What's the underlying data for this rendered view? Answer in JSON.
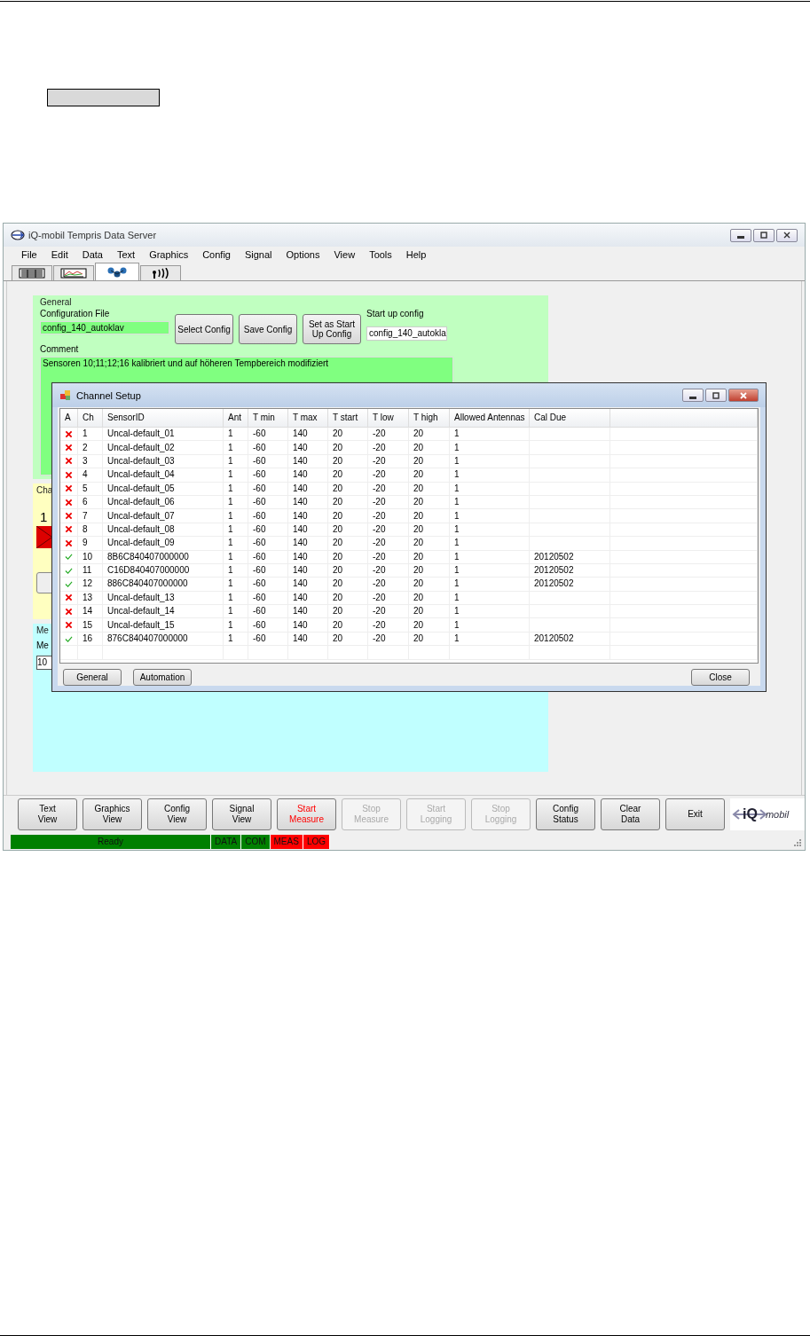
{
  "window": {
    "title": "iQ-mobil Tempris Data Server"
  },
  "menu": [
    "File",
    "Edit",
    "Data",
    "Text",
    "Graphics",
    "Config",
    "Signal",
    "Options",
    "View",
    "Tools",
    "Help"
  ],
  "tabs": [
    {
      "kind": "table",
      "selected": false
    },
    {
      "kind": "chart",
      "selected": false
    },
    {
      "kind": "network",
      "selected": true
    },
    {
      "kind": "antenna",
      "selected": false
    }
  ],
  "general": {
    "title": "General",
    "config_file_label": "Configuration File",
    "config_file": "config_140_autoklav",
    "buttons": [
      "Select Config",
      "Save Config",
      "Set as Start Up Config"
    ],
    "startup_label": "Start up config",
    "startup_value": "config_140_autokla",
    "comment_label": "Comment",
    "comment": "Sensoren 10;11;12;16 kalibriert und auf höheren Tempbereich modifiziert"
  },
  "channel_panel": {
    "title": "Cha",
    "value": "1"
  },
  "measure_panel": {
    "title": "Me",
    "label": "Me",
    "value": "10"
  },
  "dialog": {
    "title": "Channel Setup",
    "columns": [
      "A",
      "Ch",
      "SensorID",
      "Ant",
      "T min",
      "T max",
      "T start",
      "T low",
      "T high",
      "Allowed Antennas",
      "Cal Due"
    ],
    "rows": [
      {
        "active": false,
        "ch": "1",
        "sensor": "Uncal-default_01",
        "ant": "1",
        "tmin": "-60",
        "tmax": "140",
        "tstart": "20",
        "tlow": "-20",
        "thigh": "20",
        "allowed": "1",
        "cal_due": ""
      },
      {
        "active": false,
        "ch": "2",
        "sensor": "Uncal-default_02",
        "ant": "1",
        "tmin": "-60",
        "tmax": "140",
        "tstart": "20",
        "tlow": "-20",
        "thigh": "20",
        "allowed": "1",
        "cal_due": ""
      },
      {
        "active": false,
        "ch": "3",
        "sensor": "Uncal-default_03",
        "ant": "1",
        "tmin": "-60",
        "tmax": "140",
        "tstart": "20",
        "tlow": "-20",
        "thigh": "20",
        "allowed": "1",
        "cal_due": ""
      },
      {
        "active": false,
        "ch": "4",
        "sensor": "Uncal-default_04",
        "ant": "1",
        "tmin": "-60",
        "tmax": "140",
        "tstart": "20",
        "tlow": "-20",
        "thigh": "20",
        "allowed": "1",
        "cal_due": ""
      },
      {
        "active": false,
        "ch": "5",
        "sensor": "Uncal-default_05",
        "ant": "1",
        "tmin": "-60",
        "tmax": "140",
        "tstart": "20",
        "tlow": "-20",
        "thigh": "20",
        "allowed": "1",
        "cal_due": ""
      },
      {
        "active": false,
        "ch": "6",
        "sensor": "Uncal-default_06",
        "ant": "1",
        "tmin": "-60",
        "tmax": "140",
        "tstart": "20",
        "tlow": "-20",
        "thigh": "20",
        "allowed": "1",
        "cal_due": ""
      },
      {
        "active": false,
        "ch": "7",
        "sensor": "Uncal-default_07",
        "ant": "1",
        "tmin": "-60",
        "tmax": "140",
        "tstart": "20",
        "tlow": "-20",
        "thigh": "20",
        "allowed": "1",
        "cal_due": ""
      },
      {
        "active": false,
        "ch": "8",
        "sensor": "Uncal-default_08",
        "ant": "1",
        "tmin": "-60",
        "tmax": "140",
        "tstart": "20",
        "tlow": "-20",
        "thigh": "20",
        "allowed": "1",
        "cal_due": ""
      },
      {
        "active": false,
        "ch": "9",
        "sensor": "Uncal-default_09",
        "ant": "1",
        "tmin": "-60",
        "tmax": "140",
        "tstart": "20",
        "tlow": "-20",
        "thigh": "20",
        "allowed": "1",
        "cal_due": ""
      },
      {
        "active": true,
        "ch": "10",
        "sensor": "8B6C840407000000",
        "ant": "1",
        "tmin": "-60",
        "tmax": "140",
        "tstart": "20",
        "tlow": "-20",
        "thigh": "20",
        "allowed": "1",
        "cal_due": "20120502"
      },
      {
        "active": true,
        "ch": "11",
        "sensor": "C16D840407000000",
        "ant": "1",
        "tmin": "-60",
        "tmax": "140",
        "tstart": "20",
        "tlow": "-20",
        "thigh": "20",
        "allowed": "1",
        "cal_due": "20120502"
      },
      {
        "active": true,
        "ch": "12",
        "sensor": "886C840407000000",
        "ant": "1",
        "tmin": "-60",
        "tmax": "140",
        "tstart": "20",
        "tlow": "-20",
        "thigh": "20",
        "allowed": "1",
        "cal_due": "20120502"
      },
      {
        "active": false,
        "ch": "13",
        "sensor": "Uncal-default_13",
        "ant": "1",
        "tmin": "-60",
        "tmax": "140",
        "tstart": "20",
        "tlow": "-20",
        "thigh": "20",
        "allowed": "1",
        "cal_due": ""
      },
      {
        "active": false,
        "ch": "14",
        "sensor": "Uncal-default_14",
        "ant": "1",
        "tmin": "-60",
        "tmax": "140",
        "tstart": "20",
        "tlow": "-20",
        "thigh": "20",
        "allowed": "1",
        "cal_due": ""
      },
      {
        "active": false,
        "ch": "15",
        "sensor": "Uncal-default_15",
        "ant": "1",
        "tmin": "-60",
        "tmax": "140",
        "tstart": "20",
        "tlow": "-20",
        "thigh": "20",
        "allowed": "1",
        "cal_due": ""
      },
      {
        "active": true,
        "ch": "16",
        "sensor": "876C840407000000",
        "ant": "1",
        "tmin": "-60",
        "tmax": "140",
        "tstart": "20",
        "tlow": "-20",
        "thigh": "20",
        "allowed": "1",
        "cal_due": "20120502"
      }
    ],
    "left_buttons": [
      "General",
      "Automation"
    ],
    "close_button": "Close"
  },
  "toolbar": [
    {
      "label": "Text View",
      "disabled": false,
      "alert": false
    },
    {
      "label": "Graphics View",
      "disabled": false,
      "alert": false
    },
    {
      "label": "Config View",
      "disabled": false,
      "alert": false
    },
    {
      "label": "Signal View",
      "disabled": false,
      "alert": false
    },
    {
      "label": "Start Measure",
      "disabled": false,
      "alert": true
    },
    {
      "label": "Stop Measure",
      "disabled": true,
      "alert": false
    },
    {
      "label": "Start Logging",
      "disabled": true,
      "alert": false
    },
    {
      "label": "Stop Logging",
      "disabled": true,
      "alert": false
    },
    {
      "label": "Config Status",
      "disabled": false,
      "alert": false
    },
    {
      "label": "Clear Data",
      "disabled": false,
      "alert": false
    },
    {
      "label": "Exit",
      "disabled": false,
      "alert": false
    }
  ],
  "logo": {
    "mark": "iQ",
    "word": "mobil"
  },
  "status_bar": [
    {
      "label": "Ready",
      "color": "#008000"
    },
    {
      "label": "DATA",
      "color": "#008000"
    },
    {
      "label": "COM",
      "color": "#008000"
    },
    {
      "label": "MEAS",
      "color": "#ff0000"
    },
    {
      "label": "LOG",
      "color": "#ff0000"
    }
  ]
}
